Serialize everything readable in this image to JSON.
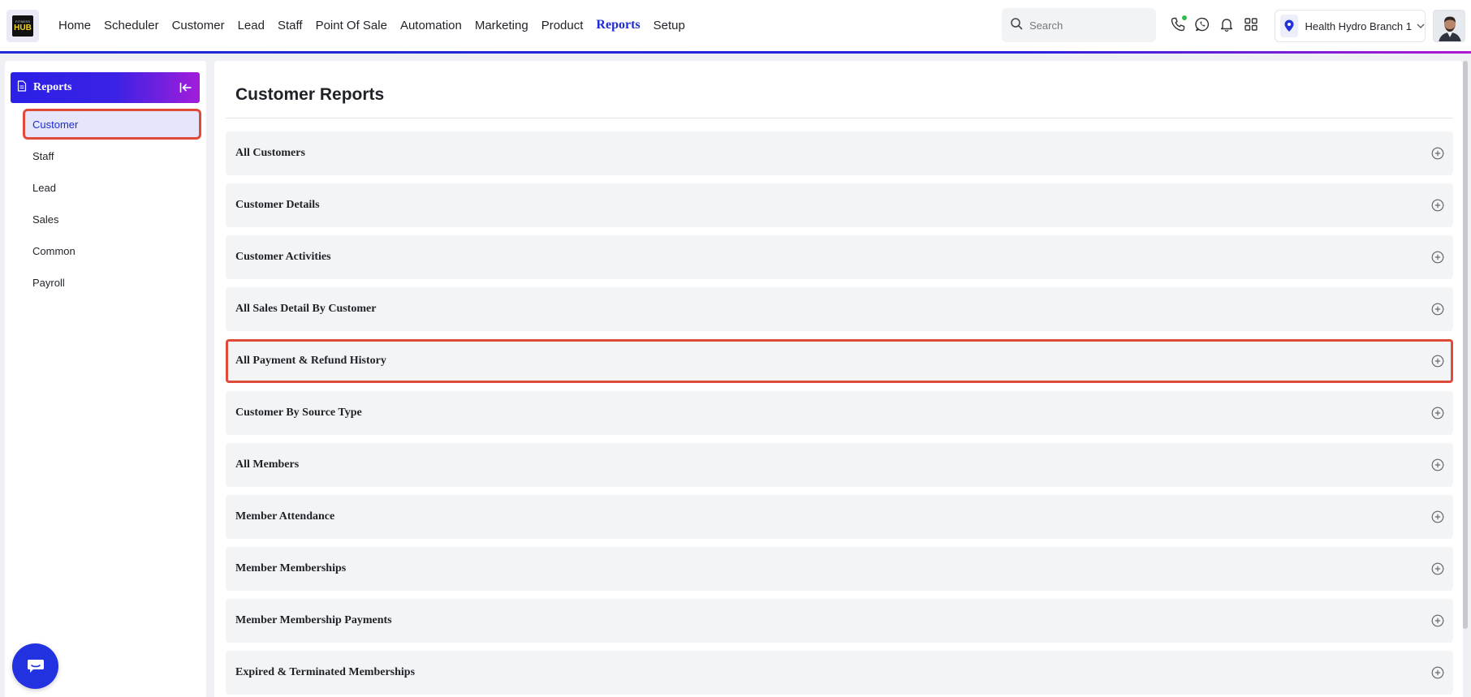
{
  "logo": {
    "small_text": "FITNESS",
    "big_text": "HUB"
  },
  "nav": {
    "items": [
      "Home",
      "Scheduler",
      "Customer",
      "Lead",
      "Staff",
      "Point Of Sale",
      "Automation",
      "Marketing",
      "Product",
      "Reports",
      "Setup"
    ],
    "active": "Reports"
  },
  "search": {
    "placeholder": "Search",
    "value": ""
  },
  "top_icons": [
    "phone-icon",
    "whatsapp-icon",
    "bell-icon",
    "apps-grid-icon"
  ],
  "branch": {
    "name": "Health Hydro Branch 1"
  },
  "sidebar": {
    "title": "Reports",
    "items": [
      "Customer",
      "Staff",
      "Lead",
      "Sales",
      "Common",
      "Payroll"
    ],
    "active": "Customer"
  },
  "main": {
    "title": "Customer Reports",
    "reports": [
      "All Customers",
      "Customer Details",
      "Customer Activities",
      "All Sales Detail By Customer",
      "All Payment & Refund History",
      "Customer By Source Type",
      "All Members",
      "Member Attendance",
      "Member Memberships",
      "Member Membership Payments",
      "Expired & Terminated Memberships"
    ],
    "highlighted": "All Payment & Refund History"
  },
  "colors": {
    "accent": "#1d2bd8",
    "highlight_border": "#e04a3a",
    "sidebar_gradient_start": "#2a20e6",
    "sidebar_gradient_end": "#a21ddb"
  }
}
